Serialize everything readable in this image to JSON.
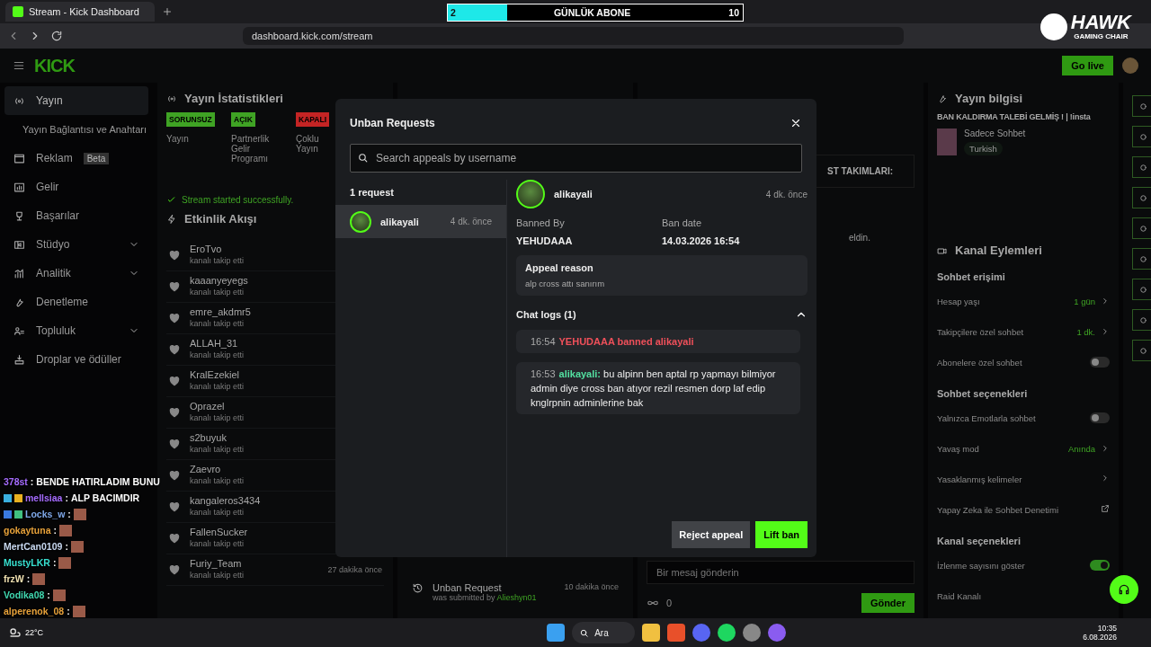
{
  "browser": {
    "tab_title": "Stream - Kick Dashboard",
    "url": "dashboard.kick.com/stream"
  },
  "sub_goal": {
    "current": "2",
    "label": "GÜNLÜK ABONE",
    "target": "10",
    "level": 0.2
  },
  "overlay_logo": {
    "name": "HAWK",
    "tagline": "GAMING CHAIR"
  },
  "top_nav": {
    "logo": "KICK",
    "go_live": "Go live"
  },
  "sidebar": {
    "items": [
      {
        "label": "Yayın",
        "kind": "item",
        "selected": true,
        "expandable": false
      },
      {
        "label": "Yayın Bağlantısı ve Anahtarı",
        "kind": "sub",
        "selected": false,
        "expandable": false
      },
      {
        "label": "Reklam",
        "kind": "item",
        "selected": false,
        "expandable": false,
        "badge": "Beta"
      },
      {
        "label": "Gelir",
        "kind": "item",
        "selected": false,
        "expandable": false
      },
      {
        "label": "Başarılar",
        "kind": "item",
        "selected": false,
        "expandable": false
      },
      {
        "label": "Stüdyo",
        "kind": "item",
        "selected": false,
        "expandable": true
      },
      {
        "label": "Analitik",
        "kind": "item",
        "selected": false,
        "expandable": true
      },
      {
        "label": "Denetleme",
        "kind": "item",
        "selected": false,
        "expandable": false
      },
      {
        "label": "Topluluk",
        "kind": "item",
        "selected": false,
        "expandable": true
      },
      {
        "label": "Droplar ve ödüller",
        "kind": "item",
        "selected": false,
        "expandable": false
      }
    ]
  },
  "stream_stats": {
    "title": "Yayın İstatistikleri",
    "statuses": [
      {
        "badge": "SORUNSUZ",
        "label": "Yayın",
        "color": "#3fa324"
      },
      {
        "badge": "AÇIK",
        "label": "Partnerlik Gelir Programı",
        "color": "#3fa324"
      },
      {
        "badge": "KAPALI",
        "label": "Çoklu Yayın",
        "color": "#c42424"
      }
    ],
    "notice": "Stream started successfully."
  },
  "activity": {
    "title": "Etkinlik Akışı",
    "events": [
      {
        "user": "EroTvo",
        "action": "kanalı takip etti"
      },
      {
        "user": "kaaanyeyegs",
        "action": "kanalı takip etti"
      },
      {
        "user": "emre_akdmr5",
        "action": "kanalı takip etti"
      },
      {
        "user": "ALLAH_31",
        "action": "kanalı takip etti"
      },
      {
        "user": "KralEzekiel",
        "action": "kanalı takip etti"
      },
      {
        "user": "Oprazel",
        "action": "kanalı takip etti"
      },
      {
        "user": "s2buyuk",
        "action": "kanalı takip etti"
      },
      {
        "user": "Zaevro",
        "action": "kanalı takip etti"
      },
      {
        "user": "kangaleros3434",
        "action": "kanalı takip etti"
      },
      {
        "user": "FallenSucker",
        "action": "kanalı takip etti"
      },
      {
        "user": "Furiy_Team",
        "action": "kanalı takip etti",
        "time": "27 dakika önce"
      }
    ]
  },
  "mod_log": {
    "entries": [
      {
        "title": "Unban Request",
        "prefix": "was submitted by",
        "user": "Alieshyn01",
        "time": "10 dakika önce"
      }
    ]
  },
  "chat": {
    "pinned": "ST TAKIMLARI:",
    "system_message": "eldin.",
    "placeholder": "Bir mesaj gönderin",
    "points": "0",
    "send": "Gönder"
  },
  "stream_info": {
    "title": "Yayın bilgisi",
    "stream_title": "BAN KALDIRMA TALEBİ GELMİŞ ! | !insta",
    "category": "Sadece Sohbet",
    "tag": "Turkish"
  },
  "channel_actions": {
    "title": "Kanal Eylemleri",
    "sections": [
      {
        "heading": "Sohbet erişimi",
        "rows": [
          {
            "label": "Hesap yaşı",
            "kind": "value",
            "value": "1 gün"
          },
          {
            "label": "Takipçilere özel sohbet",
            "kind": "value",
            "value": "1 dk."
          },
          {
            "label": "Abonelere özel sohbet",
            "kind": "toggle",
            "on": false
          }
        ]
      },
      {
        "heading": "Sohbet seçenekleri",
        "rows": [
          {
            "label": "Yalnızca Emotlarla sohbet",
            "kind": "toggle",
            "on": false
          },
          {
            "label": "Yavaş mod",
            "kind": "value",
            "value": "Anında"
          },
          {
            "label": "Yasaklanmış kelimeler",
            "kind": "link"
          },
          {
            "label": "Yapay Zeka ile Sohbet Denetimi",
            "kind": "external"
          }
        ]
      },
      {
        "heading": "Kanal seçenekleri",
        "rows": [
          {
            "label": "İzlenme sayısını göster",
            "kind": "toggle",
            "on": true
          },
          {
            "label": "Raid Kanalı",
            "kind": "plain"
          }
        ]
      }
    ]
  },
  "modal": {
    "title": "Unban Requests",
    "search_placeholder": "Search appeals by username",
    "count": "1 request",
    "requests": [
      {
        "user": "alikayali",
        "time": "4 dk. önce",
        "selected": true
      }
    ],
    "detail": {
      "user": "alikayali",
      "time": "4 dk. önce",
      "banned_by_label": "Banned By",
      "banned_by": "YEHUDAAA",
      "ban_date_label": "Ban date",
      "ban_date": "14.03.2026 16:54",
      "reason_label": "Appeal reason",
      "reason": "alp cross attı sanırım",
      "logs_title": "Chat logs (1)",
      "logs_expanded": true,
      "logs": [
        {
          "kind": "ban",
          "time": "16:54",
          "text": "YEHUDAAA banned alikayali"
        },
        {
          "kind": "message",
          "time": "16:53",
          "user": "alikayali:",
          "text": "bu alpinn ben aptal rp yapmayı bilmiyor admin diye cross ban atıyor rezil resmen dorp laf edip knglrpnin adminlerine bak"
        }
      ]
    },
    "reject": "Reject appeal",
    "lift": "Lift ban"
  },
  "stream_chat": [
    {
      "user": "378st",
      "color": "#a66cff",
      "separator": ":",
      "text": "BENDE HATIRLADIM BUNU"
    },
    {
      "user": "mellsiaa",
      "color": "#a66cff",
      "separator": ":",
      "text": "ALP BACIMDIR",
      "badges": [
        {
          "color": "#3ab0e0"
        },
        {
          "color": "#e8b020"
        }
      ]
    },
    {
      "user": "Locks_w",
      "color": "#7fa8e8",
      "separator": ":",
      "badges": [
        {
          "color": "#3a7ae0"
        },
        {
          "color": "#40c080"
        }
      ]
    },
    {
      "user": "gokaytuna",
      "color": "#e8a23a",
      "separator": ":"
    },
    {
      "user": "MertCan0109",
      "color": "#c8d8f0",
      "separator": ":"
    },
    {
      "user": "MustyLKR",
      "color": "#38e0d0",
      "separator": ":"
    },
    {
      "user": "frzW",
      "color": "#f0e0b0",
      "separator": ":"
    },
    {
      "user": "Vodika08",
      "color": "#40d8b0",
      "separator": ":"
    },
    {
      "user": "alperenok_08",
      "color": "#e8a23a",
      "separator": ":"
    }
  ],
  "taskbar": {
    "weather": "22°C",
    "search": "Ara",
    "time": "10:35",
    "date": "6.08.2026"
  }
}
